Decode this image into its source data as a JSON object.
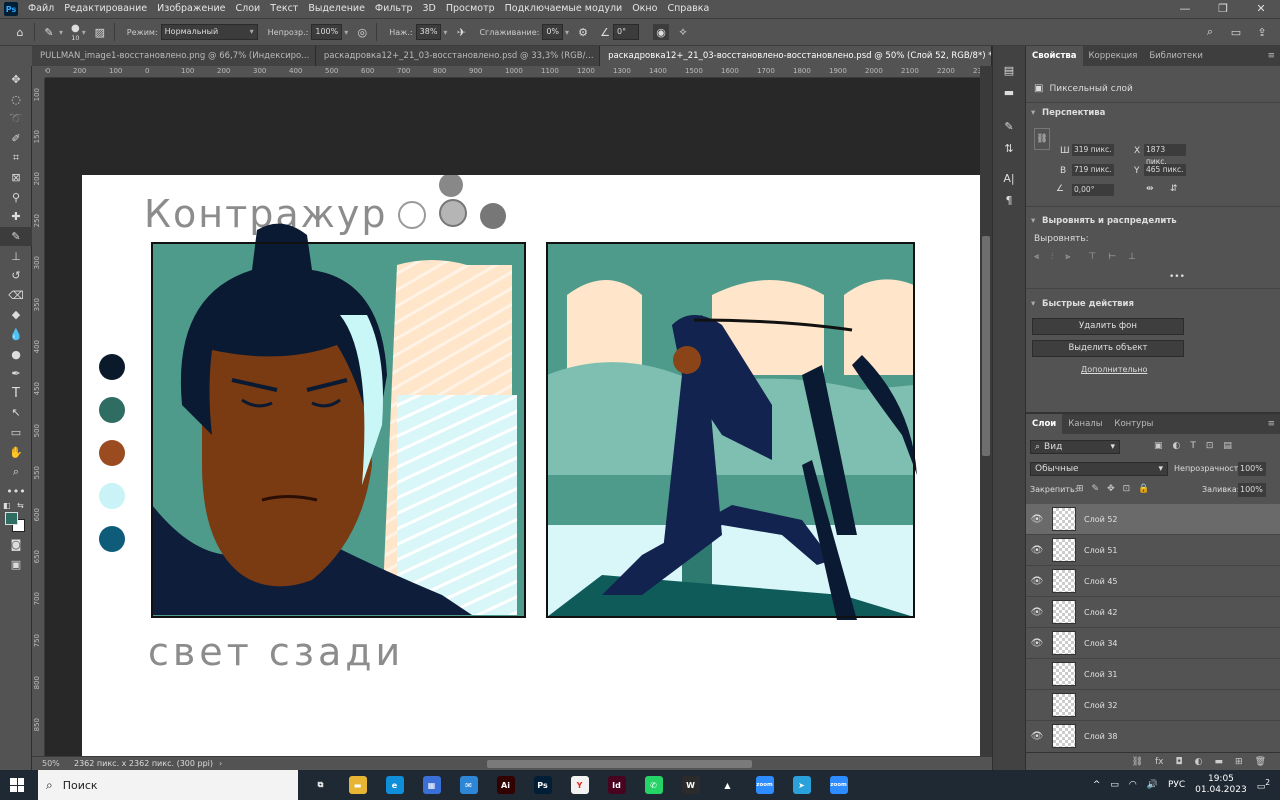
{
  "menu": {
    "items": [
      "Файл",
      "Редактирование",
      "Изображение",
      "Слои",
      "Текст",
      "Выделение",
      "Фильтр",
      "3D",
      "Просмотр",
      "Подключаемые модули",
      "Окно",
      "Справка"
    ]
  },
  "options": {
    "brush_size": "10",
    "mode_label": "Режим:",
    "mode_value": "Нормальный",
    "opacity_label": "Непрозр.:",
    "opacity_value": "100%",
    "flow_label": "Наж.:",
    "flow_value": "38%",
    "smoothing_label": "Сглаживание:",
    "smoothing_value": "0%",
    "angle_value": "0°"
  },
  "tabs": [
    {
      "label": "PULLMAN_image1-восстановлено.png @ 66,7% (Индексиро..."
    },
    {
      "label": "раскадровка12+_21_03-восстановлено.psd @ 33,3% (RGB/..."
    },
    {
      "label": "раскадровка12+_21_03-восстановлено-восстановлено.psd @ 50% (Слой 52, RGB/8*) *"
    }
  ],
  "ruler": {
    "h": [
      "300",
      "200",
      "100",
      "0",
      "100",
      "200",
      "300",
      "400",
      "500",
      "600",
      "700",
      "800",
      "900",
      "1000",
      "1100",
      "1200",
      "1300",
      "1400",
      "1500",
      "1600",
      "1700",
      "1800",
      "1900",
      "2000",
      "2100",
      "2200",
      "2300"
    ],
    "v": [
      "100",
      "150",
      "200",
      "250",
      "300",
      "350",
      "400",
      "450",
      "500",
      "550",
      "600",
      "650",
      "700",
      "750",
      "800",
      "850"
    ]
  },
  "artwork": {
    "text_top": "Контражур",
    "text_bottom": "свет сзади",
    "swatches": [
      "#0b1a2a",
      "#2f6d63",
      "#9a4b20",
      "#c9f3f6",
      "#0e5b7a"
    ]
  },
  "status": {
    "zoom": "50%",
    "size": "2362 пикс. x 2362 пикс. (300 ppi)"
  },
  "properties": {
    "tabs": [
      "Свойства",
      "Коррекция",
      "Библиотеки"
    ],
    "layer_type": "Пиксельный слой",
    "perspective": "Перспектива",
    "w_label": "Ш",
    "w_value": "319 пикс.",
    "x_label": "X",
    "x_value": "1873 пикс.",
    "h_label": "В",
    "h_value": "719 пикс.",
    "y_label": "Y",
    "y_value": "465 пикс.",
    "angle_value": "0,00°",
    "align_title": "Выровнять и распределить",
    "align_label": "Выровнять:",
    "quick_title": "Быстрые действия",
    "btn_remove_bg": "Удалить фон",
    "btn_select": "Выделить объект",
    "more": "Дополнительно"
  },
  "layers_panel": {
    "tabs": [
      "Слои",
      "Каналы",
      "Контуры"
    ],
    "filter": "Вид",
    "blend": "Обычные",
    "opacity_label": "Непрозрачность:",
    "opacity_value": "100%",
    "lock_label": "Закрепить:",
    "fill_label": "Заливка:",
    "fill_value": "100%",
    "layers": [
      {
        "name": "Слой 52",
        "visible": true,
        "selected": true
      },
      {
        "name": "Слой 51",
        "visible": true
      },
      {
        "name": "Слой 45",
        "visible": true
      },
      {
        "name": "Слой 42",
        "visible": true
      },
      {
        "name": "Слой 34",
        "visible": true
      },
      {
        "name": "Слой 31",
        "visible": false
      },
      {
        "name": "Слой 32",
        "visible": false
      },
      {
        "name": "Слой 38",
        "visible": true
      }
    ]
  },
  "taskbar": {
    "search": "Поиск",
    "lang": "РУС",
    "time": "19:05",
    "date": "01.04.2023",
    "notif": "2",
    "apps": [
      {
        "name": "task-view",
        "c": "#1f2933",
        "g": "⧉"
      },
      {
        "name": "explorer",
        "c": "#e7b533",
        "g": "▬"
      },
      {
        "name": "edge",
        "c": "#0f8fd9",
        "g": "e"
      },
      {
        "name": "calculator",
        "c": "#3b6fd8",
        "g": "▦"
      },
      {
        "name": "mail",
        "c": "#2d86d6",
        "g": "✉"
      },
      {
        "name": "illustrator",
        "c": "#330000",
        "g": "Ai"
      },
      {
        "name": "photoshop",
        "c": "#001e36",
        "g": "Ps"
      },
      {
        "name": "yandex",
        "c": "#f2f2f2",
        "g": "Y"
      },
      {
        "name": "indesign",
        "c": "#49021f",
        "g": "Id"
      },
      {
        "name": "whatsapp",
        "c": "#25d366",
        "g": "✆"
      },
      {
        "name": "wacom",
        "c": "#2b2b2b",
        "g": "W"
      },
      {
        "name": "google-drive",
        "c": "#1f2933",
        "g": "▲"
      },
      {
        "name": "zoom",
        "c": "#2d8cff",
        "g": "zoom"
      },
      {
        "name": "telegram",
        "c": "#2aa1db",
        "g": "➤"
      },
      {
        "name": "zoom-2",
        "c": "#2d8cff",
        "g": "zoom"
      }
    ]
  }
}
